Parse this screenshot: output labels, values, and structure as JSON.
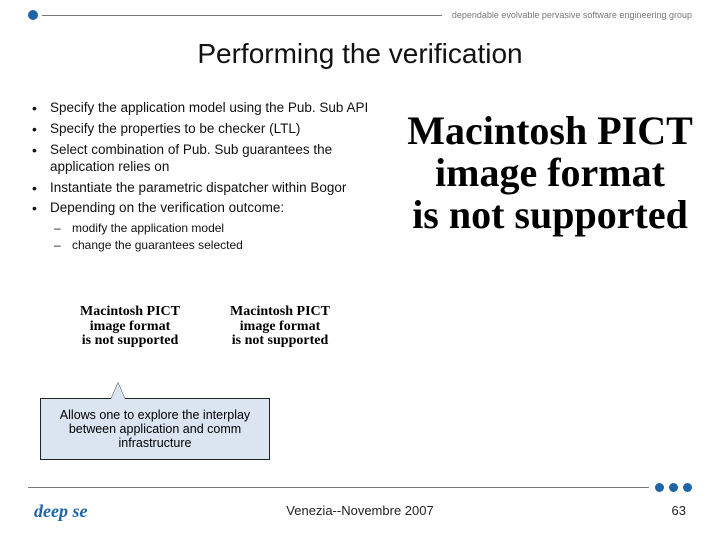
{
  "header": {
    "tagline": "dependable evolvable pervasive software engineering group"
  },
  "title": "Performing the verification",
  "bullets": [
    "Specify the application model using the Pub. Sub API",
    "Specify the properties to be checker (LTL)",
    "Select combination of Pub. Sub guarantees the application relies on",
    "Instantiate the parametric dispatcher within Bogor",
    "Depending on the verification outcome:"
  ],
  "sub_bullets": [
    "modify the application model",
    "change the guarantees selected"
  ],
  "pict": {
    "l1": "Macintosh PICT",
    "l2": "image format",
    "l3": "is not supported"
  },
  "callout": "Allows one to explore the interplay between application and comm infrastructure",
  "footer": {
    "venue": "Venezia--Novembre 2007",
    "page": "63",
    "logo": "deep se"
  }
}
